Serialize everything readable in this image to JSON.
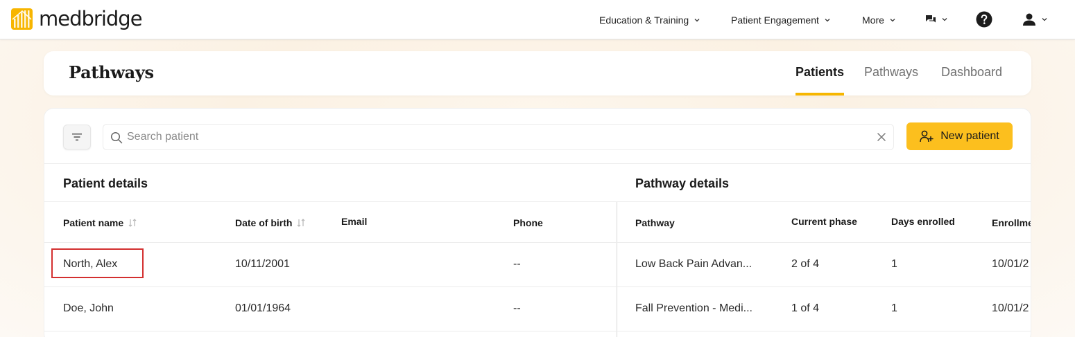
{
  "app": {
    "logo_text": "medbridge",
    "nav": [
      {
        "label": "Education & Training"
      },
      {
        "label": "Patient Engagement"
      },
      {
        "label": "More"
      }
    ],
    "icons": {
      "messages": "chat-bubbles-icon",
      "help": "help-circle-icon",
      "account": "user-icon"
    },
    "brand_color": "#f6b600"
  },
  "header": {
    "title": "Pathways",
    "tabs": [
      {
        "label": "Patients",
        "active": true
      },
      {
        "label": "Pathways",
        "active": false
      },
      {
        "label": "Dashboard",
        "active": false
      }
    ]
  },
  "toolbar": {
    "search_placeholder": "Search patient",
    "search_value": "",
    "new_patient_label": "New patient",
    "accent_color": "#fcbf1e"
  },
  "table": {
    "sections": {
      "patient": "Patient details",
      "pathway": "Pathway details"
    },
    "columns": {
      "patient_name": "Patient name",
      "date_of_birth": "Date of birth",
      "email": "Email",
      "phone": "Phone",
      "pathway": "Pathway",
      "current_phase": "Current phase",
      "days_enrolled": "Days enrolled",
      "enrollment": "Enrollme"
    },
    "rows": [
      {
        "name": "North, Alex",
        "dob": "10/11/2001",
        "email": "",
        "phone": "--",
        "pathway": "Low Back Pain Advan...",
        "phase": "2 of 4",
        "days": "1",
        "enrollment": "10/01/2"
      },
      {
        "name": "Doe, John",
        "dob": "01/01/1964",
        "email": "",
        "phone": "--",
        "pathway": "Fall Prevention - Medi...",
        "phase": "1 of 4",
        "days": "1",
        "enrollment": "10/01/2"
      }
    ]
  }
}
